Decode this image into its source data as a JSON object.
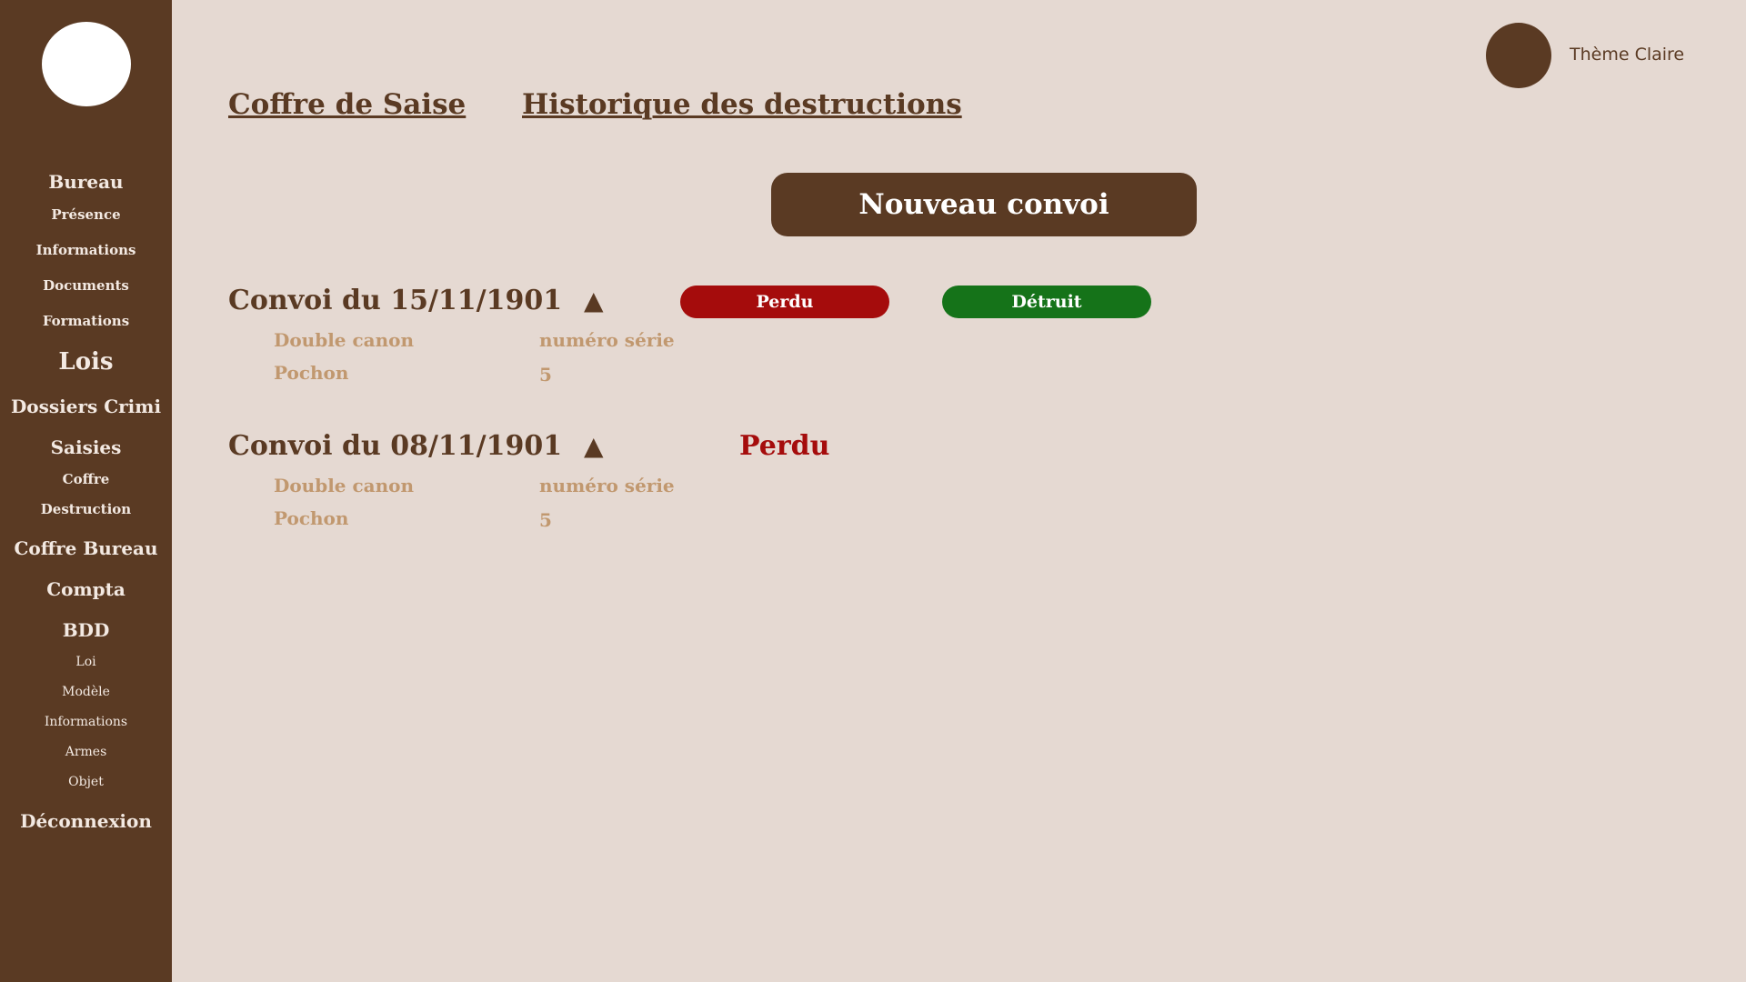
{
  "sidebar": {
    "items": [
      {
        "label": "Bureau"
      },
      {
        "label": "Présence"
      },
      {
        "label": "Informations"
      },
      {
        "label": "Documents"
      },
      {
        "label": "Formations"
      },
      {
        "label": "Lois"
      },
      {
        "label": "Dossiers Crimi"
      },
      {
        "label": "Saisies"
      },
      {
        "label": "Coffre"
      },
      {
        "label": "Destruction"
      },
      {
        "label": "Coffre Bureau"
      },
      {
        "label": "Compta"
      },
      {
        "label": "BDD"
      },
      {
        "label": "Loi"
      },
      {
        "label": "Modèle"
      },
      {
        "label": "Informations"
      },
      {
        "label": "Armes"
      },
      {
        "label": "Objet"
      },
      {
        "label": "Déconnexion"
      }
    ]
  },
  "header": {
    "theme_label": "Thème Claire",
    "links": [
      "Coffre de Saise",
      "Historique des destructions"
    ],
    "new_button_label": "Nouveau convoi"
  },
  "convoys": [
    {
      "title": "Convoi du 15/11/1901",
      "arrow": "▲",
      "lost_button": "Perdu",
      "destroyed_button": "Détruit",
      "items": [
        {
          "name": "Double canon",
          "value": "numéro série"
        },
        {
          "name": "Pochon",
          "value": "5"
        }
      ]
    },
    {
      "title": "Convoi du 08/11/1901",
      "arrow": "▲",
      "status": "Perdu",
      "items": [
        {
          "name": "Double canon",
          "value": "numéro série"
        },
        {
          "name": "Pochon",
          "value": "5"
        }
      ]
    }
  ],
  "colors": {
    "sidebar_bg": "#5a3a23",
    "page_bg": "#e5d9d2",
    "lost_red": "#a50c0c",
    "destroyed_green": "#157319",
    "item_tan": "#c1986f"
  }
}
